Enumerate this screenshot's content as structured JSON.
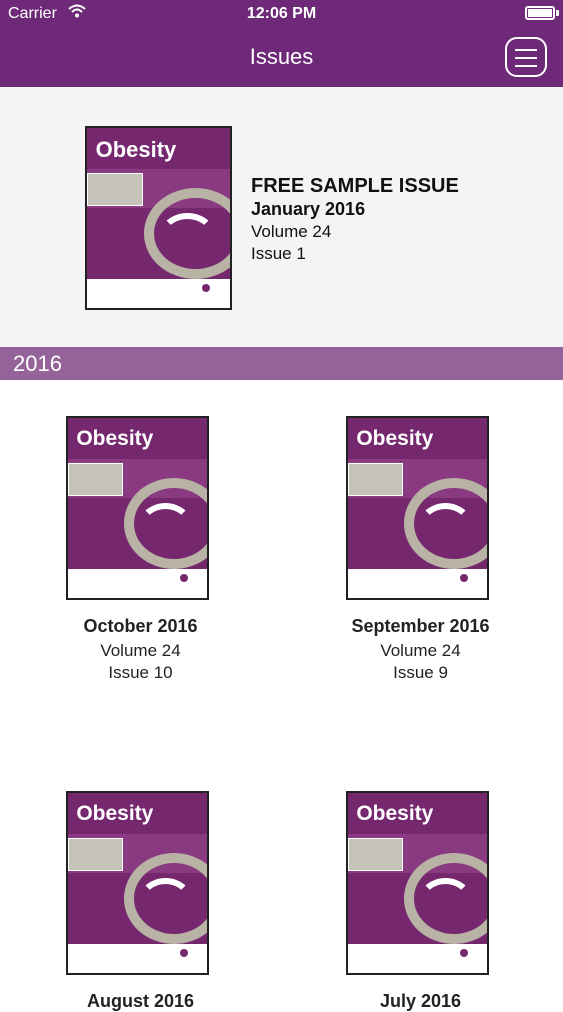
{
  "status": {
    "carrier": "Carrier",
    "time": "12:06 PM"
  },
  "nav": {
    "title": "Issues"
  },
  "featured": {
    "cover_logo": "Obesity",
    "label": "FREE SAMPLE ISSUE",
    "date": "January 2016",
    "volume": "Volume 24",
    "issue": "Issue 1"
  },
  "section": {
    "year": "2016"
  },
  "issues": [
    {
      "cover_logo": "Obesity",
      "title": "October 2016",
      "volume": "Volume 24",
      "issue": "Issue 10"
    },
    {
      "cover_logo": "Obesity",
      "title": "September 2016",
      "volume": "Volume 24",
      "issue": "Issue 9"
    },
    {
      "cover_logo": "Obesity",
      "title": "August 2016"
    },
    {
      "cover_logo": "Obesity",
      "title": "July 2016"
    }
  ],
  "colors": {
    "brand": "#6e2a78",
    "section_header": "#93639a"
  },
  "icons": {
    "menu": "hamburger-menu-icon",
    "wifi": "wifi-icon",
    "battery": "battery-icon"
  }
}
